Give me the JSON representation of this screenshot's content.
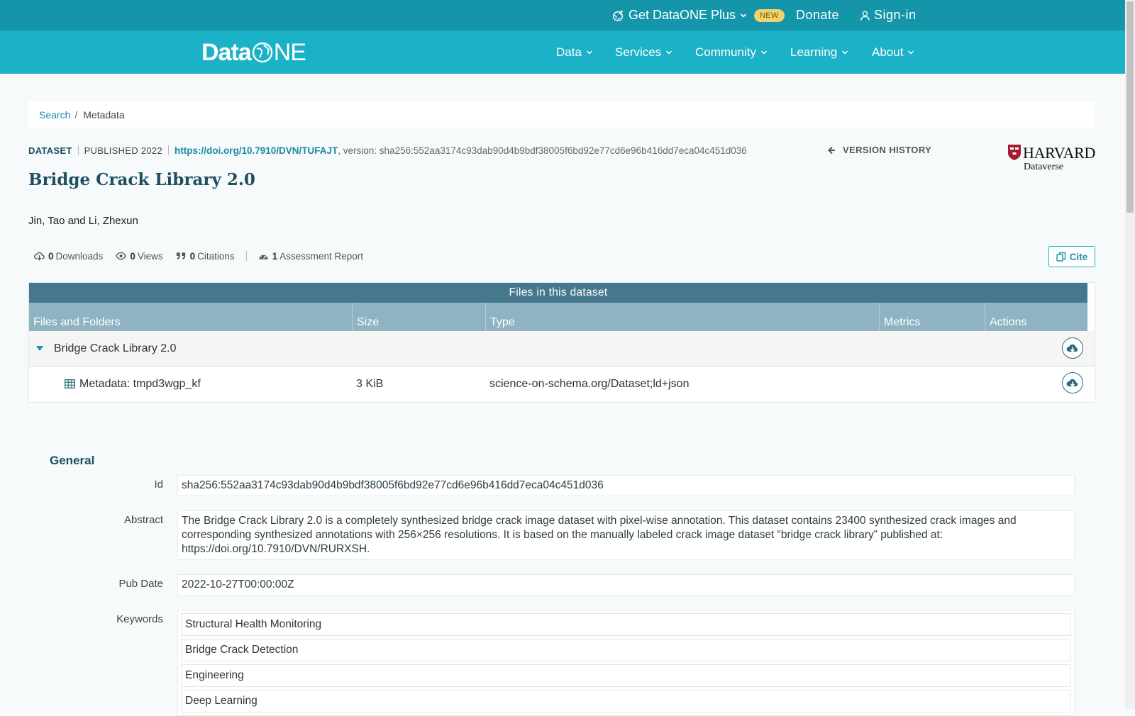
{
  "topbar": {
    "plus_label": "Get DataONE Plus",
    "plus_badge": "NEW",
    "donate_label": "Donate",
    "signin_label": "Sign-in"
  },
  "navbar": {
    "logo_text_data": "Data",
    "logo_text_one": "NE",
    "items": [
      {
        "label": "Data"
      },
      {
        "label": "Services"
      },
      {
        "label": "Community"
      },
      {
        "label": "Learning"
      },
      {
        "label": "About"
      }
    ]
  },
  "breadcrumb": {
    "search": "Search",
    "sep": "/",
    "current": "Metadata"
  },
  "dataset": {
    "type": "DATASET",
    "published": "PUBLISHED 2022",
    "doi": "https://doi.org/10.7910/DVN/TUFAJT",
    "version": ", version: sha256:552aa3174c93dab90d4b9bdf38005f6bd92e77cd6e96b416dd7eca04c451d036",
    "version_history": "VERSION HISTORY",
    "repository_line1": "HARVARD",
    "repository_line2": "Dataverse",
    "title": "Bridge Crack Library 2.0",
    "authors": "Jin, Tao and Li, Zhexun"
  },
  "metrics": {
    "downloads_count": "0",
    "downloads_label": "Downloads",
    "views_count": "0",
    "views_label": "Views",
    "citations_count": "0",
    "citations_label": "Citations",
    "assessment_count": "1",
    "assessment_label": "Assessment Report",
    "cite_label": "Cite"
  },
  "files": {
    "header": "Files in this dataset",
    "columns": [
      "Files and Folders",
      "Size",
      "Type",
      "Metrics",
      "Actions"
    ],
    "folder": {
      "name": "Bridge Crack Library 2.0"
    },
    "rows": [
      {
        "name": "Metadata: tmpd3wgp_kf",
        "size": "3 KiB",
        "type": "science-on-schema.org/Dataset;ld+json"
      }
    ]
  },
  "general": {
    "heading": "General",
    "id_label": "Id",
    "id_value": "sha256:552aa3174c93dab90d4b9bdf38005f6bd92e77cd6e96b416dd7eca04c451d036",
    "abstract_label": "Abstract",
    "abstract_value": "The Bridge Crack Library 2.0 is a completely synthesized bridge crack image dataset with pixel-wise annotation. This dataset contains 23400 synthesized crack images and corresponding synthesized annotations with 256×256 resolutions. It is based on the manually labeled crack image dataset “bridge crack library” published at: https://doi.org/10.7910/DVN/RURXSH.",
    "pubdate_label": "Pub Date",
    "pubdate_value": "2022-10-27T00:00:00Z",
    "keywords_label": "Keywords",
    "keywords": [
      "Structural Health Monitoring",
      "Bridge Crack Detection",
      "Engineering",
      "Deep Learning"
    ]
  },
  "colors": {
    "topbar": "#1595a9",
    "navbar": "#1bb1c6",
    "table_header": "#45788c",
    "table_columns": "#8fb3c2",
    "title": "#1d4f61",
    "link": "#1a8aa6",
    "badge": "#f2d36b"
  }
}
